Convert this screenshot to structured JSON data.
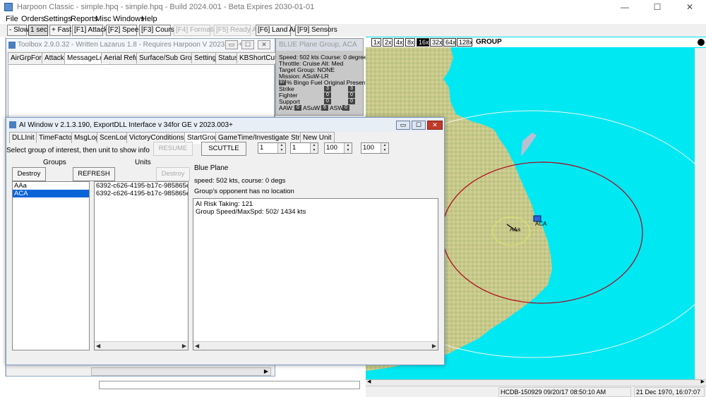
{
  "window": {
    "title": "Harpoon Classic - simple.hpq - simple.hpq - Build 2024.001 - Beta Expires 2030-01-01",
    "minimize": "—",
    "maximize": "☐",
    "close": "✕"
  },
  "menu": [
    "File",
    "Orders",
    "Settings",
    "Reports",
    "Misc",
    "Windows",
    "Help"
  ],
  "toolbar": [
    {
      "label": "- Slow",
      "state": "normal"
    },
    {
      "label": "1 sec",
      "state": "active"
    },
    {
      "label": "+ Fast",
      "state": "normal"
    },
    {
      "label": "[F1] Attack",
      "state": "normal"
    },
    {
      "label": "[F2] Speed",
      "state": "normal"
    },
    {
      "label": "[F3] Course",
      "state": "normal"
    },
    {
      "label": "[F4] Formation",
      "state": "disabled"
    },
    {
      "label": "[F5] Ready Air",
      "state": "disabled"
    },
    {
      "label": "[F6] Land Air",
      "state": "normal"
    },
    {
      "label": "[F9] Sensors",
      "state": "normal"
    }
  ],
  "toolbox": {
    "title": "Toolbox 2.9.0.32 - Written Lazarus 1.8 - Requires Harpoon V 2023.006+",
    "tabs": [
      "AirGrpForm",
      "Attack",
      "MessageLog",
      "Aerial Refuel",
      "Surface/Sub Groups",
      "Settings",
      "Status",
      "KBShortCuts"
    ],
    "selected_tab": "MessageLog"
  },
  "info_panel": {
    "title": "BLUE Plane Group, ACA",
    "speed": "Speed: 502 kts   Course: 0 degrees",
    "throttle": "Throttle: Cruise    Alt: Med",
    "target": "Target Group: NONE",
    "mission": "Mission: ASuW-LR",
    "bingo_value": "97",
    "bingo_label": "% Bingo Fuel   Original      Present",
    "rows": [
      {
        "label": "Strike",
        "original": "3",
        "present": "3"
      },
      {
        "label": "Fighter",
        "original": "0",
        "present": "0"
      },
      {
        "label": "Support",
        "original": "0",
        "present": "0"
      }
    ],
    "aaw_label": "AAW:",
    "aaw": "0",
    "asuw_label": "ASuW:",
    "asuw": "6",
    "asw_label": "ASW:",
    "asw": "0"
  },
  "map": {
    "zoom_levels": [
      "1x",
      "2x",
      "4x",
      "8x",
      "16x",
      "32x",
      "64x",
      "128x"
    ],
    "selected_zoom": "16x",
    "mode_label": "GROUP",
    "unit_labels": [
      "AAa",
      "ACA"
    ],
    "water_color": "#00e8f2",
    "land_color": "#c7c98a"
  },
  "ai_window": {
    "title": "AI Window v 2.1.3.190, ExportDLL Interface v 34for GE v 2023.003+",
    "tabs": [
      "DLLInit",
      "TimeFactor",
      "MsgLog",
      "ScenLoad",
      "VictoryConditionsList",
      "StartGroup",
      "GameTime/Investigate Structures",
      "New Unit"
    ],
    "selected_tab": "StartGroup",
    "instruction": "Select group of interest, then unit to show info",
    "resume_label": "RESUME",
    "scuttle_label": "SCUTTLE",
    "spinners": [
      "1",
      "1",
      "100",
      "100"
    ],
    "groups_label": "Groups",
    "units_label": "Units",
    "destroy_label": "Destroy",
    "refresh_label": "REFRESH",
    "groups": [
      "AAa",
      "ACA"
    ],
    "selected_group": "ACA",
    "units": [
      "6392-c626-4195-b17c-985865e6392b",
      "6392-c626-4195-b17c-985865e6392b"
    ],
    "info_title": "Blue Plane",
    "speed_course": "speed: 502 kts, course: 0 degs",
    "opponent": "Group's opponent  has no location",
    "details": [
      "AI Risk Taking: 121",
      "Group Speed/MaxSpd: 502/ 1434 kts"
    ]
  },
  "status_bar": {
    "db": "HCDB-150929 09/20/17 08:50:10 AM",
    "date": "21 Dec 1970, 16:07:07"
  }
}
